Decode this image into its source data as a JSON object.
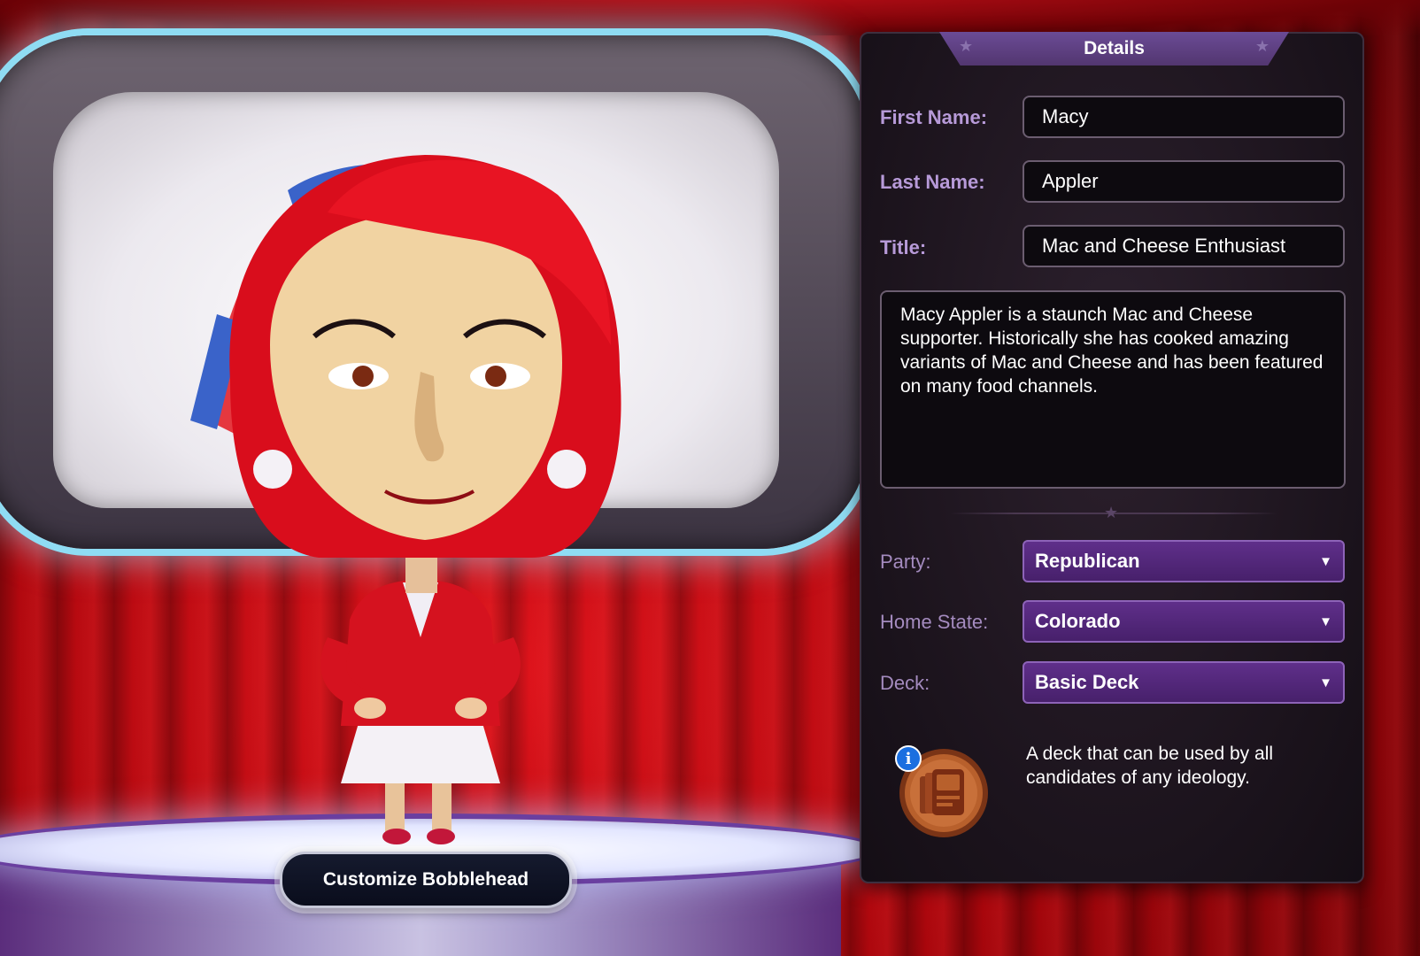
{
  "preview": {
    "customize_button_label": "Customize Bobblehead"
  },
  "details": {
    "header": "Details",
    "fields": {
      "first_name": {
        "label": "First Name:",
        "value": "Macy"
      },
      "last_name": {
        "label": "Last Name:",
        "value": "Appler"
      },
      "title": {
        "label": "Title:",
        "value": "Mac and Cheese Enthusiast"
      }
    },
    "bio": "Macy Appler is a staunch Mac and Cheese supporter. Historically she has cooked amazing variants of Mac and Cheese and has been featured on many food channels.",
    "selects": {
      "party": {
        "label": "Party:",
        "value": "Republican"
      },
      "home_state": {
        "label": "Home State:",
        "value": "Colorado"
      },
      "deck": {
        "label": "Deck:",
        "value": "Basic Deck"
      }
    },
    "deck_info": {
      "badge": "i",
      "description": "A deck that can be used by all candidates of any ideology."
    }
  },
  "colors": {
    "accent_purple": "#5f2f8a",
    "label_lavender": "#b79ad8",
    "curtain_red": "#c8101a",
    "info_blue": "#1a6fe0",
    "deck_copper": "#b8602c"
  },
  "icons": {
    "dropdown": "triangle-down-icon",
    "header_star": "star-icon",
    "deck": "card-deck-icon",
    "info": "info-icon"
  }
}
